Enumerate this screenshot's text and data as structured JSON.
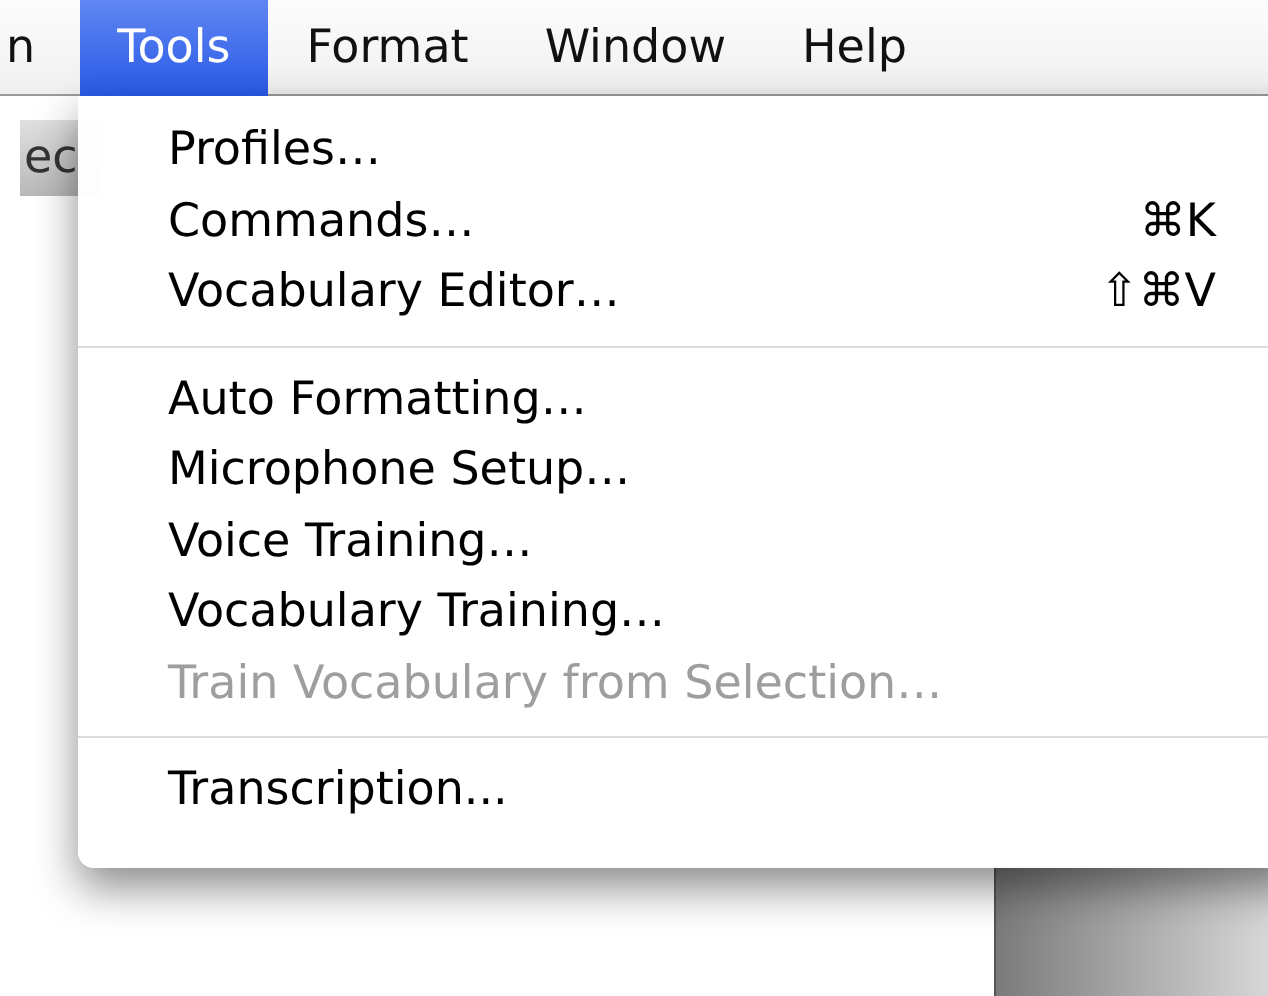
{
  "menubar": [
    {
      "label": "n",
      "selected": false
    },
    {
      "label": "Tools",
      "selected": true
    },
    {
      "label": "Format",
      "selected": false
    },
    {
      "label": "Window",
      "selected": false
    },
    {
      "label": "Help",
      "selected": false
    }
  ],
  "background_button": {
    "label": "ec"
  },
  "menu": {
    "groups": [
      [
        {
          "label": "Profiles…",
          "disabled": false
        },
        {
          "label": "Commands…",
          "shortcut": "⌘K",
          "disabled": false
        },
        {
          "label": "Vocabulary Editor…",
          "shortcut": "⇧⌘V",
          "disabled": false
        }
      ],
      [
        {
          "label": "Auto Formatting…",
          "disabled": false
        },
        {
          "label": "Microphone Setup…",
          "disabled": false
        },
        {
          "label": "Voice Training…",
          "disabled": false
        },
        {
          "label": "Vocabulary Training…",
          "disabled": false
        },
        {
          "label": "Train Vocabulary from Selection…",
          "disabled": true
        }
      ],
      [
        {
          "label": "Transcription...",
          "disabled": false
        }
      ]
    ]
  }
}
